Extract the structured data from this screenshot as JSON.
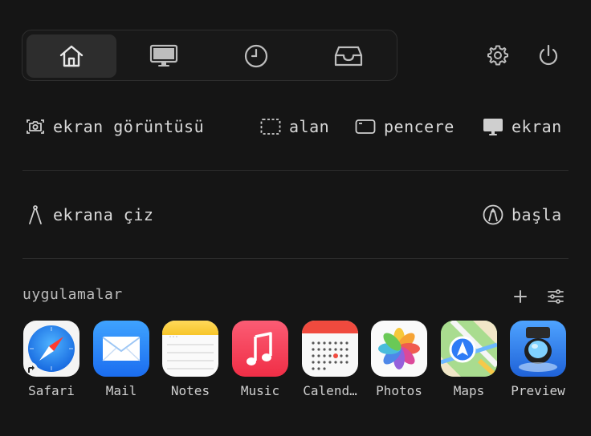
{
  "tabs": [
    {
      "icon": "home-icon",
      "active": true
    },
    {
      "icon": "display-icon",
      "active": false
    },
    {
      "icon": "clock-icon",
      "active": false
    },
    {
      "icon": "tray-icon",
      "active": false
    }
  ],
  "toolbar": {
    "settings_icon": "gear-icon",
    "power_icon": "power-icon"
  },
  "capture": {
    "label": "ekran görüntüsü",
    "options": [
      {
        "icon": "dashed-rect-icon",
        "label": "alan"
      },
      {
        "icon": "window-icon",
        "label": "pencere"
      },
      {
        "icon": "monitor-icon",
        "label": "ekran"
      }
    ]
  },
  "draw": {
    "label": "ekrana çiz",
    "action_label": "başla"
  },
  "apps_section": {
    "title": "uygulamalar",
    "apps": [
      {
        "name": "Safari"
      },
      {
        "name": "Mail"
      },
      {
        "name": "Notes"
      },
      {
        "name": "Music"
      },
      {
        "name": "Calend…"
      },
      {
        "name": "Photos"
      },
      {
        "name": "Maps"
      },
      {
        "name": "Preview"
      }
    ]
  },
  "colors": {
    "background": "#151515",
    "text": "#d9d9d9",
    "active_tab": "#2d2d2d"
  }
}
